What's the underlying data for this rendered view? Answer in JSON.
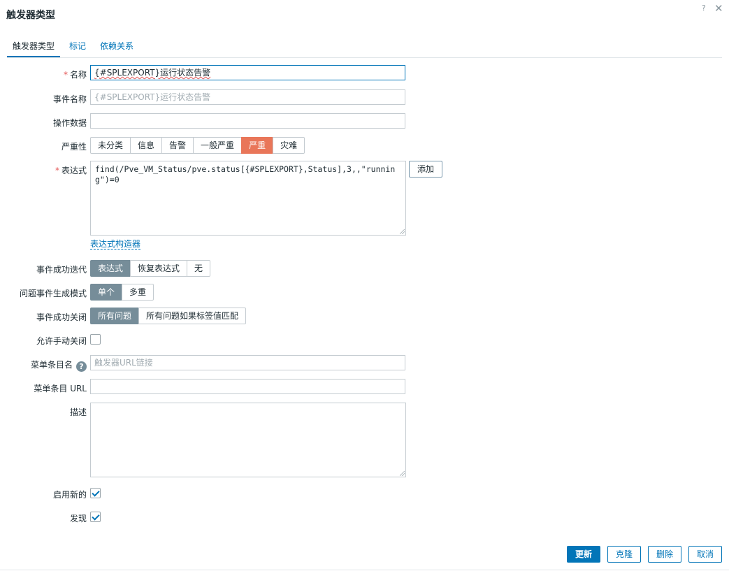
{
  "dialog": {
    "title": "触发器类型",
    "help": "?",
    "close": "✕"
  },
  "tabs": [
    "触发器类型",
    "标记",
    "依赖关系"
  ],
  "form": {
    "name": {
      "label": "名称",
      "value": "{#SPLEXPORT}运行状态告警"
    },
    "event_name": {
      "label": "事件名称",
      "placeholder": "{#SPLEXPORT}运行状态告警"
    },
    "opdata": {
      "label": "操作数据",
      "value": ""
    },
    "severity": {
      "label": "严重性",
      "options": [
        "未分类",
        "信息",
        "告警",
        "一般严重",
        "严重",
        "灾难"
      ],
      "selected": "严重"
    },
    "expression": {
      "label": "表达式",
      "value": "find(/Pve_VM_Status/pve.status[{#SPLEXPORT},Status],3,,\"running\")=0",
      "add_label": "添加",
      "constructor_link": "表达式构造器"
    },
    "ok_event_gen": {
      "label": "事件成功迭代",
      "options": [
        "表达式",
        "恢复表达式",
        "无"
      ],
      "selected": "表达式"
    },
    "problem_mode": {
      "label": "问题事件生成模式",
      "options": [
        "单个",
        "多重"
      ],
      "selected": "单个"
    },
    "ok_close": {
      "label": "事件成功关闭",
      "options": [
        "所有问题",
        "所有问题如果标签值匹配"
      ],
      "selected": "所有问题"
    },
    "manual_close": {
      "label": "允许手动关闭",
      "checked": false
    },
    "url_name": {
      "label": "菜单条目名",
      "placeholder": "触发器URL链接"
    },
    "url": {
      "label": "菜单条目 URL",
      "value": ""
    },
    "description": {
      "label": "描述",
      "value": ""
    },
    "enabled": {
      "label": "启用新的",
      "checked": true
    },
    "discover": {
      "label": "发现",
      "checked": true
    }
  },
  "buttons": {
    "update": "更新",
    "clone": "克隆",
    "delete": "删除",
    "cancel": "取消"
  },
  "colors": {
    "accent": "#0275b8",
    "selected_segment": "#768d99",
    "high_severity": "#e97659"
  }
}
